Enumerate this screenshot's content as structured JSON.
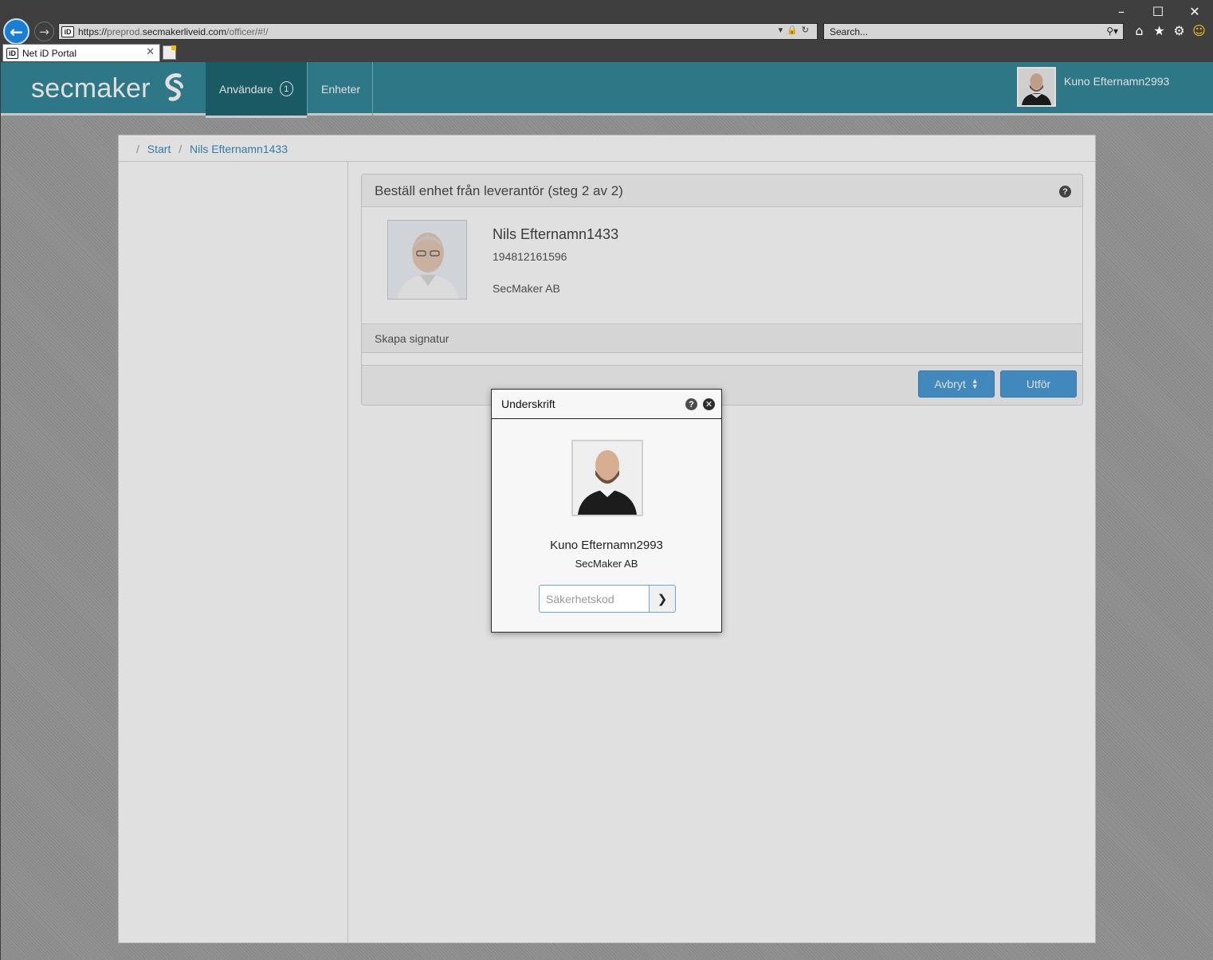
{
  "browser": {
    "url_prefix": "https://",
    "url_host_dim": "preprod.",
    "url_host": "secmakerliveid.com",
    "url_path": "/officer/#!/",
    "search_placeholder": "Search...",
    "tab_title": "Net iD Portal",
    "favicon_text": "iD",
    "window_controls": {
      "minimize": "–",
      "maximize": "☐",
      "close": "✕"
    },
    "toolbar_icons": [
      "home-icon",
      "star-icon",
      "gear-icon",
      "smiley-icon"
    ]
  },
  "header": {
    "logo_text": "secmaker",
    "nav": [
      {
        "label": "Användare",
        "badge": "1",
        "active": true
      },
      {
        "label": "Enheter",
        "active": false
      }
    ],
    "user_name": "Kuno Efternamn2993"
  },
  "breadcrumb": {
    "items": [
      "Start",
      "Nils Efternamn1433"
    ]
  },
  "panel": {
    "title": "Beställ enhet från leverantör (steg 2 av 2)",
    "help": "?",
    "person": {
      "name": "Nils Efternamn1433",
      "personal_number": "194812161596",
      "organization": "SecMaker AB"
    },
    "section_title": "Skapa signatur",
    "buttons": {
      "cancel": "Avbryt",
      "submit": "Utför"
    }
  },
  "modal": {
    "title": "Underskrift",
    "help": "?",
    "close": "✕",
    "signer_name": "Kuno Efternamn2993",
    "signer_org": "SecMaker AB",
    "pin_placeholder": "Säkerhetskod",
    "pin_value": "",
    "submit_glyph": "❯"
  },
  "colors": {
    "header_bg": "#35889a",
    "nav_active": "#1e6774",
    "accent_blue": "#4b9bd8",
    "link": "#3b8dbd"
  }
}
